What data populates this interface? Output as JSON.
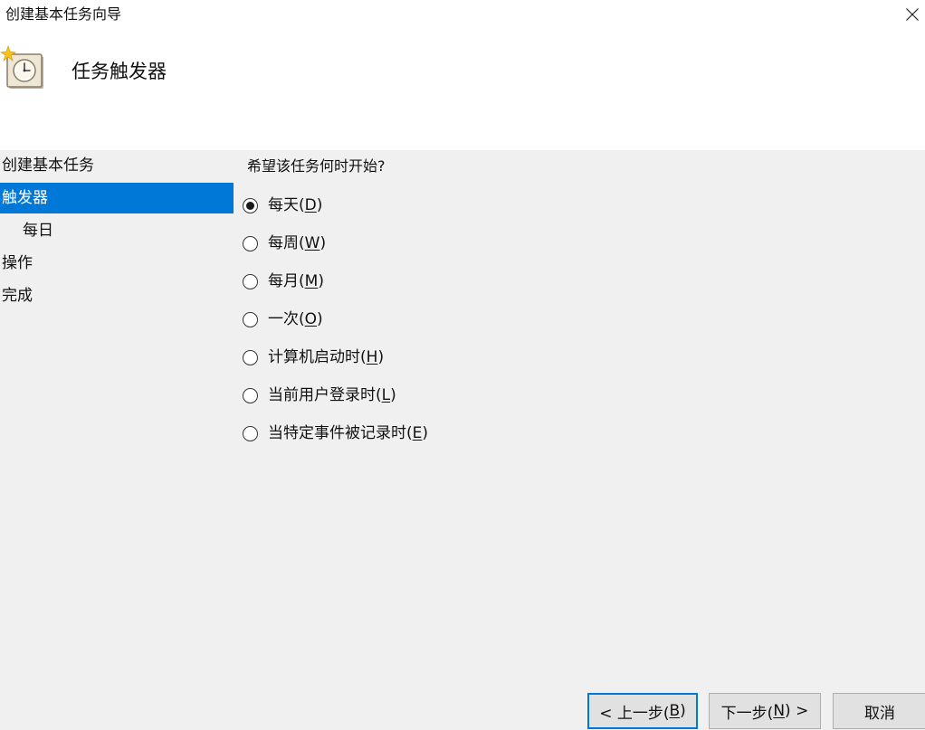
{
  "window": {
    "title": "创建基本任务向导"
  },
  "header": {
    "title": "任务触发器",
    "icon": "task-scheduler-clock-icon"
  },
  "sidebar": {
    "steps": [
      {
        "label": "创建基本任务",
        "active": false,
        "sub": false
      },
      {
        "label": "触发器",
        "active": true,
        "sub": false
      },
      {
        "label": "每日",
        "active": false,
        "sub": true
      },
      {
        "label": "操作",
        "active": false,
        "sub": false
      },
      {
        "label": "完成",
        "active": false,
        "sub": false
      }
    ]
  },
  "main": {
    "question": "希望该任务何时开始?",
    "options": [
      {
        "text": "每天(",
        "key": "D",
        "suffix": ")",
        "selected": true
      },
      {
        "text": "每周(",
        "key": "W",
        "suffix": ")",
        "selected": false
      },
      {
        "text": "每月(",
        "key": "M",
        "suffix": ")",
        "selected": false
      },
      {
        "text": "一次(",
        "key": "O",
        "suffix": ")",
        "selected": false
      },
      {
        "text": "计算机启动时(",
        "key": "H",
        "suffix": ")",
        "selected": false
      },
      {
        "text": "当前用户登录时(",
        "key": "L",
        "suffix": ")",
        "selected": false
      },
      {
        "text": "当特定事件被记录时(",
        "key": "E",
        "suffix": ")",
        "selected": false
      }
    ]
  },
  "footer": {
    "back": {
      "prefix": "< 上一步(",
      "key": "B",
      "suffix": ")"
    },
    "next": {
      "prefix": "下一步(",
      "key": "N",
      "suffix": ") >"
    },
    "cancel": "取消"
  },
  "colors": {
    "accent": "#0078d7",
    "panel_background": "#f0f0f0",
    "header_background": "#ffffff"
  }
}
